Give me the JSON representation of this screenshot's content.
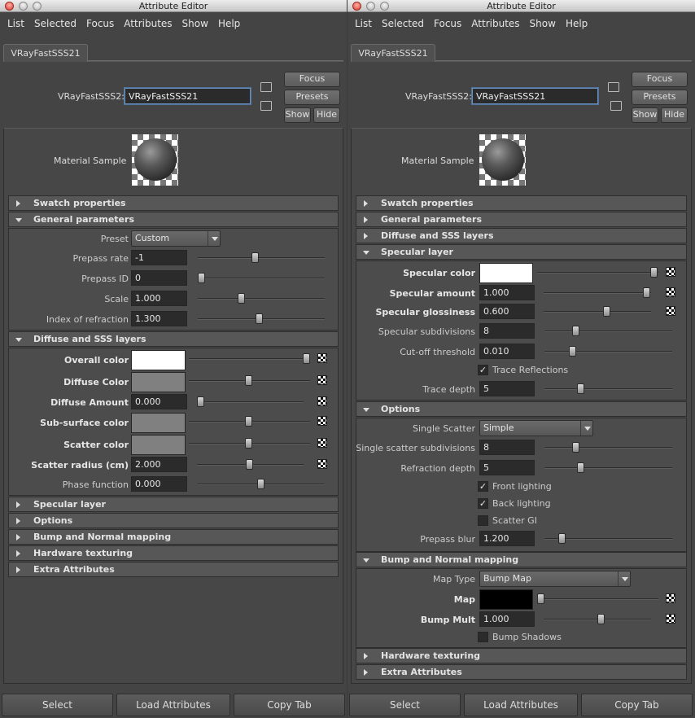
{
  "window_title": "Attribute Editor",
  "menu": [
    "List",
    "Selected",
    "Focus",
    "Attributes",
    "Show",
    "Help"
  ],
  "tab_label": "VRayFastSSS21",
  "node_label": "VRayFastSSS2:",
  "node_name": "VRayFastSSS21",
  "buttons": {
    "focus": "Focus",
    "presets": "Presets",
    "show": "Show",
    "hide": "Hide"
  },
  "material_sample": "Material Sample",
  "bottom_buttons": {
    "select": "Select",
    "load": "Load Attributes",
    "copy": "Copy Tab"
  },
  "sections": {
    "swatch": "Swatch properties",
    "general": "General parameters",
    "diffuse": "Diffuse and SSS layers",
    "specular": "Specular layer",
    "options": "Options",
    "bump": "Bump and Normal mapping",
    "hardware": "Hardware texturing",
    "extra": "Extra Attributes"
  },
  "general": {
    "preset_label": "Preset",
    "preset_value": "Custom",
    "prepass_rate_label": "Prepass rate",
    "prepass_rate": "-1",
    "prepass_rate_pos": 0.45,
    "prepass_id_label": "Prepass ID",
    "prepass_id": "0",
    "prepass_id_pos": 0.0,
    "scale_label": "Scale",
    "scale": "1.000",
    "scale_pos": 0.33,
    "ior_label": "Index of refraction",
    "ior": "1.300",
    "ior_pos": 0.48
  },
  "diffuse": {
    "overall_color_label": "Overall color",
    "overall_color": "#ffffff",
    "diffuse_color_label": "Diffuse Color",
    "diffuse_color": "#808080",
    "diffuse_amount_label": "Diffuse Amount",
    "diffuse_amount": "0.000",
    "subsurface_color_label": "Sub-surface color",
    "subsurface_color": "#808080",
    "scatter_color_label": "Scatter color",
    "scatter_color": "#808080",
    "scatter_radius_label": "Scatter radius (cm)",
    "scatter_radius": "2.000",
    "phase_function_label": "Phase function",
    "phase_function": "0.000"
  },
  "specular": {
    "specular_color_label": "Specular color",
    "specular_color": "#ffffff",
    "specular_amount_label": "Specular amount",
    "specular_amount": "1.000",
    "specular_glossiness_label": "Specular glossiness",
    "specular_glossiness": "0.600",
    "specular_subdivisions_label": "Specular subdivisions",
    "specular_subdivisions": "8",
    "cutoff_label": "Cut-off threshold",
    "cutoff": "0.010",
    "trace_reflections_label": "Trace Reflections",
    "trace_depth_label": "Trace depth",
    "trace_depth": "5"
  },
  "options": {
    "single_scatter_label": "Single Scatter",
    "single_scatter_value": "Simple",
    "single_scatter_subdiv_label": "Single scatter subdivisions",
    "single_scatter_subdiv": "8",
    "refraction_depth_label": "Refraction depth",
    "refraction_depth": "5",
    "front_lighting_label": "Front lighting",
    "back_lighting_label": "Back lighting",
    "scatter_gi_label": "Scatter GI",
    "prepass_blur_label": "Prepass blur",
    "prepass_blur": "1.200"
  },
  "bump": {
    "map_type_label": "Map Type",
    "map_type_value": "Bump Map",
    "map_label": "Map",
    "map_color": "#000000",
    "bump_mult_label": "Bump Mult",
    "bump_mult": "1.000",
    "bump_shadows_label": "Bump Shadows"
  },
  "check_mark": "✓"
}
